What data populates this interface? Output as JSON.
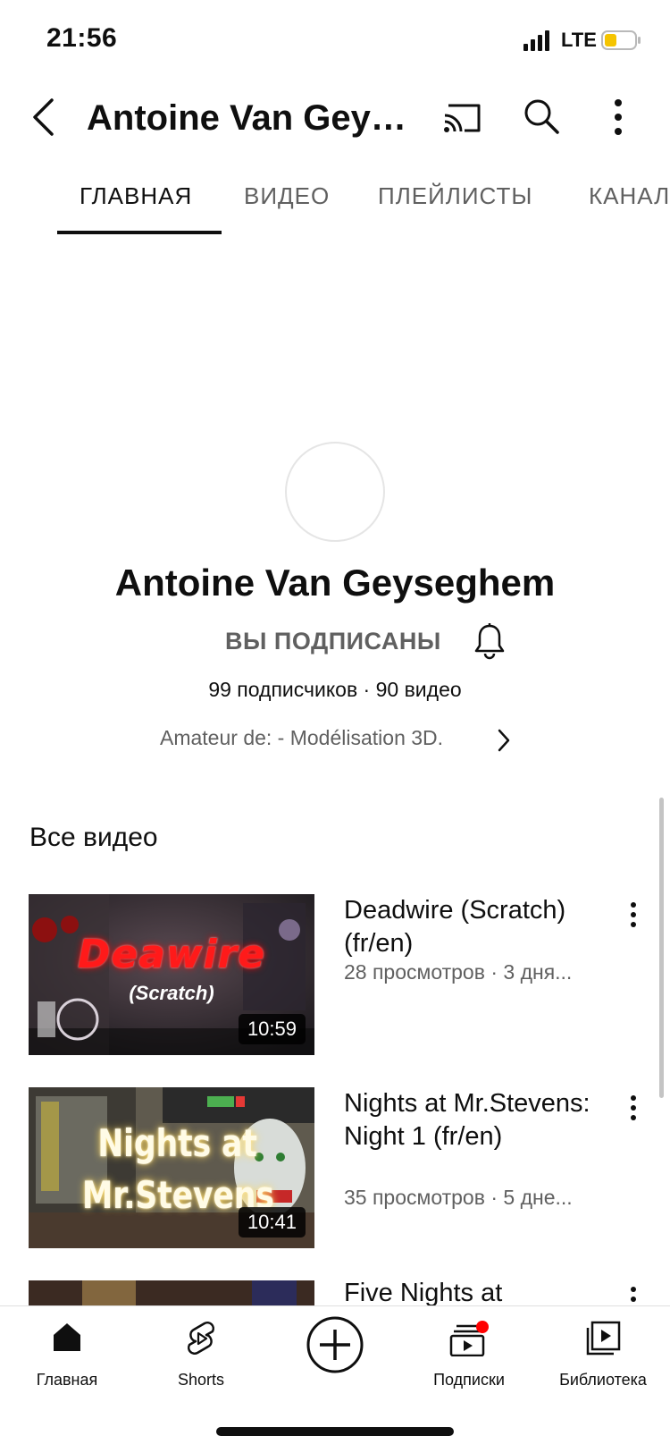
{
  "status_bar": {
    "time": "21:56",
    "network": "LTE",
    "battery_color": "#f5c400"
  },
  "header": {
    "title": "Antoine Van Geys...",
    "back_icon": "chevron-left-icon",
    "cast_icon": "cast-icon",
    "search_icon": "search-icon",
    "menu_icon": "more-vertical-icon"
  },
  "tabs": [
    {
      "label": "ГЛАВНАЯ",
      "active": true
    },
    {
      "label": "ВИДЕО",
      "active": false
    },
    {
      "label": "ПЛЕЙЛИСТЫ",
      "active": false
    },
    {
      "label": "КАНАЛ",
      "active": false
    }
  ],
  "channel": {
    "name": "Antoine Van Geyseghem",
    "subscribed_label": "ВЫ ПОДПИСАНЫ",
    "stats": "99 подписчиков · 90 видео",
    "description": "Amateur de: - Modélisation 3D."
  },
  "section_title": "Все видео",
  "videos": [
    {
      "title": "Deadwire (Scratch) (fr/en)",
      "meta": "28 просмотров · 3 дня...",
      "duration": "10:59",
      "thumb_text": "Deawire",
      "thumb_subtext": "(Scratch)"
    },
    {
      "title": "Nights at Mr.Stevens: Night 1 (fr/en)",
      "meta": "35 просмотров · 5 дне...",
      "duration": "10:41",
      "thumb_text": "Nights at Mr.Stevens"
    },
    {
      "title": "Five Nights at",
      "meta": "",
      "duration": ""
    }
  ],
  "bottom_nav": [
    {
      "label": "Главная",
      "icon": "home-icon",
      "active": true
    },
    {
      "label": "Shorts",
      "icon": "shorts-icon"
    },
    {
      "label": "",
      "icon": "create-plus-icon"
    },
    {
      "label": "Подписки",
      "icon": "subscriptions-icon",
      "badge_color": "#ff0000"
    },
    {
      "label": "Библиотека",
      "icon": "library-icon"
    }
  ]
}
